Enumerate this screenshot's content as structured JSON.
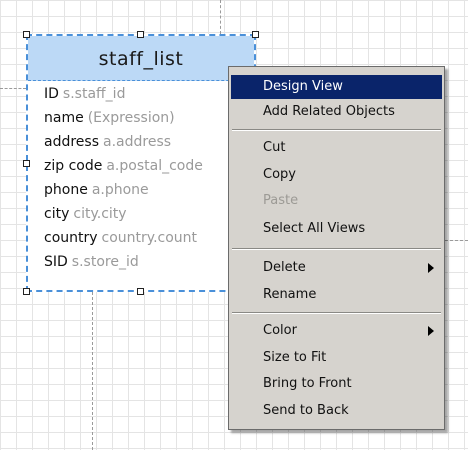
{
  "entity": {
    "title": "staff_list",
    "fields": [
      {
        "name": "ID",
        "source": "s.staff_id"
      },
      {
        "name": "name",
        "source": "(Expression)"
      },
      {
        "name": "address",
        "source": "a.address"
      },
      {
        "name": "zip code",
        "source": "a.postal_code"
      },
      {
        "name": "phone",
        "source": "a.phone"
      },
      {
        "name": "city",
        "source": "city.city"
      },
      {
        "name": "country",
        "source": "country.count"
      },
      {
        "name": "SID",
        "source": "s.store_id"
      }
    ]
  },
  "context_menu": {
    "items": [
      {
        "label": "Design View",
        "selected": true
      },
      {
        "label": "Add Related Objects"
      },
      {
        "label": "Cut"
      },
      {
        "label": "Copy"
      },
      {
        "label": "Paste",
        "disabled": true
      },
      {
        "label": "Select All Views"
      },
      {
        "label": "Delete",
        "submenu": true
      },
      {
        "label": "Rename"
      },
      {
        "label": "Color",
        "submenu": true
      },
      {
        "label": "Size to Fit"
      },
      {
        "label": "Bring to Front"
      },
      {
        "label": "Send to Back"
      }
    ],
    "icons": {
      "submenu": "triangle-right-icon"
    }
  },
  "colors": {
    "selection_bg": "#0a246a",
    "menu_bg": "#d6d3ce",
    "entity_header": "#bcd9f6",
    "entity_border": "#4a90d9"
  }
}
